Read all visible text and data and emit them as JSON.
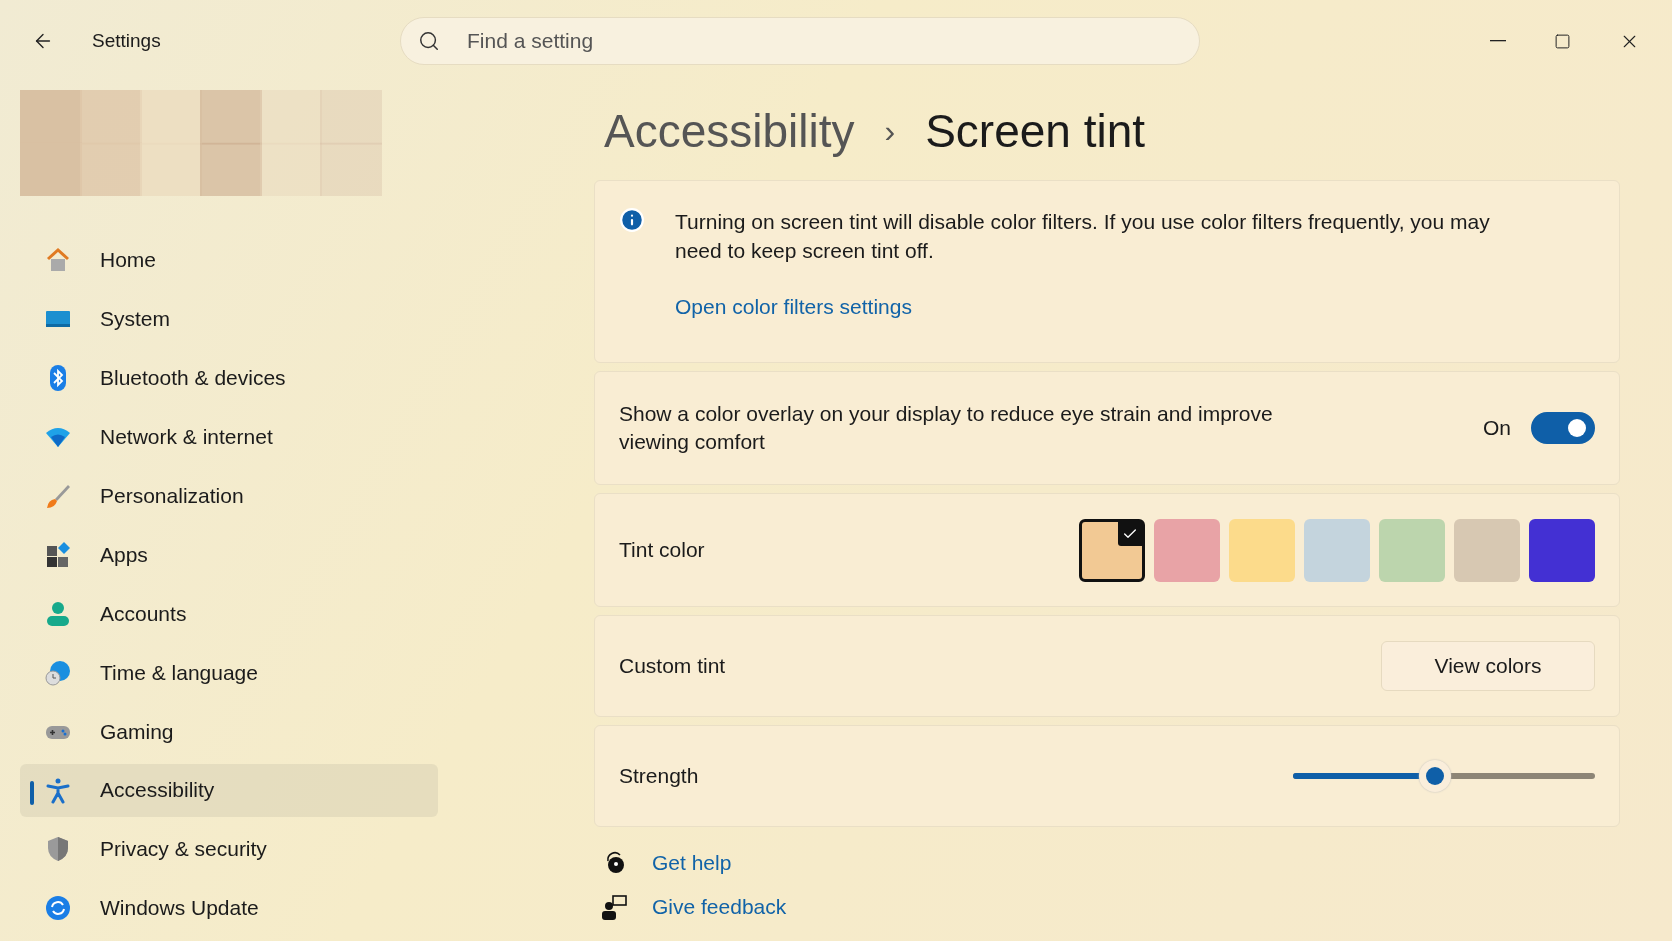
{
  "window": {
    "title": "Settings"
  },
  "search": {
    "placeholder": "Find a setting"
  },
  "sidebar": {
    "items": [
      {
        "label": "Home",
        "selected": false
      },
      {
        "label": "System",
        "selected": false
      },
      {
        "label": "Bluetooth & devices",
        "selected": false
      },
      {
        "label": "Network & internet",
        "selected": false
      },
      {
        "label": "Personalization",
        "selected": false
      },
      {
        "label": "Apps",
        "selected": false
      },
      {
        "label": "Accounts",
        "selected": false
      },
      {
        "label": "Time & language",
        "selected": false
      },
      {
        "label": "Gaming",
        "selected": false
      },
      {
        "label": "Accessibility",
        "selected": true
      },
      {
        "label": "Privacy & security",
        "selected": false
      },
      {
        "label": "Windows Update",
        "selected": false
      }
    ]
  },
  "breadcrumb": {
    "parent": "Accessibility",
    "separator": "›",
    "current": "Screen tint"
  },
  "info": {
    "text": "Turning on screen tint will disable color filters. If you use color filters frequently, you may need to keep screen tint off.",
    "link": "Open color filters settings"
  },
  "overlay": {
    "label": "Show a color overlay on your display to reduce eye strain and improve viewing comfort",
    "state_label": "On",
    "on": true
  },
  "tint": {
    "label": "Tint color",
    "swatches": [
      {
        "color": "#f2c994",
        "selected": true
      },
      {
        "color": "#e8a3a6",
        "selected": false
      },
      {
        "color": "#fcdb8b",
        "selected": false
      },
      {
        "color": "#c4d4dd",
        "selected": false
      },
      {
        "color": "#bcd5ad",
        "selected": false
      },
      {
        "color": "#d7c8b2",
        "selected": false
      },
      {
        "color": "#4330d3",
        "selected": false
      }
    ]
  },
  "custom_tint": {
    "label": "Custom tint",
    "button": "View colors"
  },
  "strength": {
    "label": "Strength",
    "level": 0.47
  },
  "help_links": [
    "Get help",
    "Give feedback"
  ]
}
